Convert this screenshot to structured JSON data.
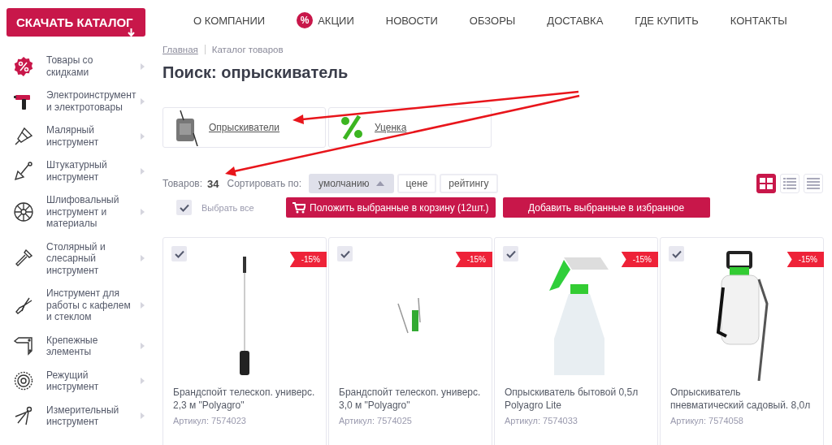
{
  "catalog_button": {
    "label": "СКАЧАТЬ КАТАЛОГ"
  },
  "nav": [
    {
      "label": "О КОМПАНИИ"
    },
    {
      "label": "АКЦИИ",
      "badge": "%"
    },
    {
      "label": "НОВОСТИ"
    },
    {
      "label": "ОБЗОРЫ"
    },
    {
      "label": "ДОСТАВКА"
    },
    {
      "label": "ГДЕ КУПИТЬ"
    },
    {
      "label": "КОНТАКТЫ"
    }
  ],
  "sidebar": {
    "items": [
      {
        "label": "Товары со скидками"
      },
      {
        "label": "Электроинструмент и электротовары"
      },
      {
        "label": "Малярный инструмент"
      },
      {
        "label": "Штукатурный инструмент"
      },
      {
        "label": "Шлифовальный инструмент и материалы"
      },
      {
        "label": "Столярный и слесарный инструмент"
      },
      {
        "label": "Инструмент для работы с кафелем и стеклом"
      },
      {
        "label": "Крепежные элементы"
      },
      {
        "label": "Режущий инструмент"
      },
      {
        "label": "Измерительный инструмент"
      }
    ]
  },
  "breadcrumbs": [
    {
      "label": "Главная",
      "link": true
    },
    {
      "label": "Каталог товаров",
      "link": false
    }
  ],
  "title": "Поиск: опрыскиватель",
  "categories": [
    {
      "label": "Опрыскиватели"
    },
    {
      "label": "Уценка"
    }
  ],
  "toolbar": {
    "count_label": "Товаров:",
    "count": "34",
    "sort_label": "Сортировать по:",
    "sort_options": [
      {
        "label": "умолчанию",
        "selected": true
      },
      {
        "label": "цене",
        "selected": false
      },
      {
        "label": "рейтингу",
        "selected": false
      }
    ],
    "view_modes": [
      {
        "selected": true
      },
      {
        "selected": false
      },
      {
        "selected": false
      }
    ]
  },
  "select_all": {
    "label": "Выбрать все",
    "checked": true
  },
  "actions": [
    {
      "label": "Положить выбранные в корзину (12шт.)"
    },
    {
      "label": "Добавить выбранные в избранное"
    }
  ],
  "products": [
    {
      "name": "Брандспойт телескоп. универс. 2,3 м \"Polyagro\"",
      "article": "Артикул: 7574023",
      "badge": "-15%",
      "checked": true
    },
    {
      "name": "Брандспойт телескоп. универс. 3,0 м \"Polyagro\"",
      "article": "Артикул: 7574025",
      "badge": "-15%",
      "checked": true
    },
    {
      "name": "Опрыскиватель бытовой 0,5л Polyagro Lite",
      "article": "Артикул: 7574033",
      "badge": "-15%",
      "checked": true
    },
    {
      "name": "Опрыскиватель пневматический садовый. 8,0л",
      "article": "Артикул: 7574058",
      "badge": "-15%",
      "checked": true
    }
  ]
}
